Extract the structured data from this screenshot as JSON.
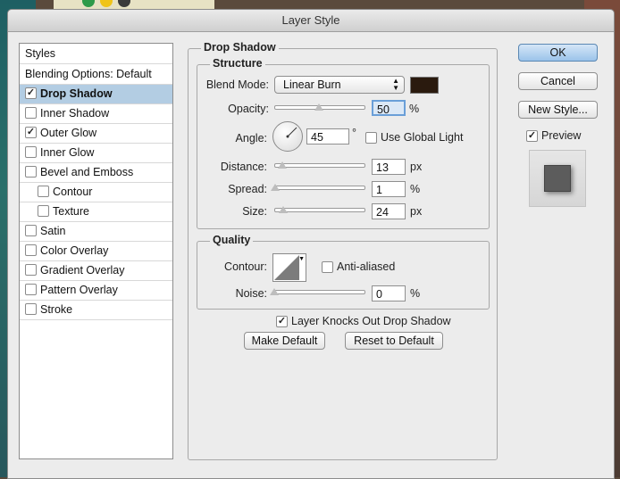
{
  "dialog": {
    "title": "Layer Style"
  },
  "styles_list": {
    "header": "Styles",
    "blending": "Blending Options: Default",
    "items": [
      {
        "label": "Drop Shadow",
        "checked": true,
        "selected": true,
        "sub": false
      },
      {
        "label": "Inner Shadow",
        "checked": false,
        "selected": false,
        "sub": false
      },
      {
        "label": "Outer Glow",
        "checked": true,
        "selected": false,
        "sub": false
      },
      {
        "label": "Inner Glow",
        "checked": false,
        "selected": false,
        "sub": false
      },
      {
        "label": "Bevel and Emboss",
        "checked": false,
        "selected": false,
        "sub": false
      },
      {
        "label": "Contour",
        "checked": false,
        "selected": false,
        "sub": true
      },
      {
        "label": "Texture",
        "checked": false,
        "selected": false,
        "sub": true
      },
      {
        "label": "Satin",
        "checked": false,
        "selected": false,
        "sub": false
      },
      {
        "label": "Color Overlay",
        "checked": false,
        "selected": false,
        "sub": false
      },
      {
        "label": "Gradient Overlay",
        "checked": false,
        "selected": false,
        "sub": false
      },
      {
        "label": "Pattern Overlay",
        "checked": false,
        "selected": false,
        "sub": false
      },
      {
        "label": "Stroke",
        "checked": false,
        "selected": false,
        "sub": false
      }
    ]
  },
  "drop_shadow": {
    "title": "Drop Shadow",
    "structure": {
      "title": "Structure",
      "blend_mode_label": "Blend Mode:",
      "blend_mode_value": "Linear Burn",
      "blend_color": "#2a1a0e",
      "opacity_label": "Opacity:",
      "opacity_value": "50",
      "opacity_unit": "%",
      "angle_label": "Angle:",
      "angle_value": "45",
      "angle_unit": "°",
      "global_light_label": "Use Global Light",
      "global_light_checked": false,
      "distance_label": "Distance:",
      "distance_value": "13",
      "distance_unit": "px",
      "spread_label": "Spread:",
      "spread_value": "1",
      "spread_unit": "%",
      "size_label": "Size:",
      "size_value": "24",
      "size_unit": "px"
    },
    "quality": {
      "title": "Quality",
      "contour_label": "Contour:",
      "anti_aliased_label": "Anti-aliased",
      "anti_aliased_checked": false,
      "noise_label": "Noise:",
      "noise_value": "0",
      "noise_unit": "%"
    },
    "knockout_label": "Layer Knocks Out Drop Shadow",
    "knockout_checked": true,
    "make_default": "Make Default",
    "reset_default": "Reset to Default"
  },
  "buttons": {
    "ok": "OK",
    "cancel": "Cancel",
    "new_style": "New Style...",
    "preview_label": "Preview",
    "preview_checked": true
  },
  "colors": {
    "accent": "#b3cde3",
    "ok_button": "#9bc3ea"
  }
}
